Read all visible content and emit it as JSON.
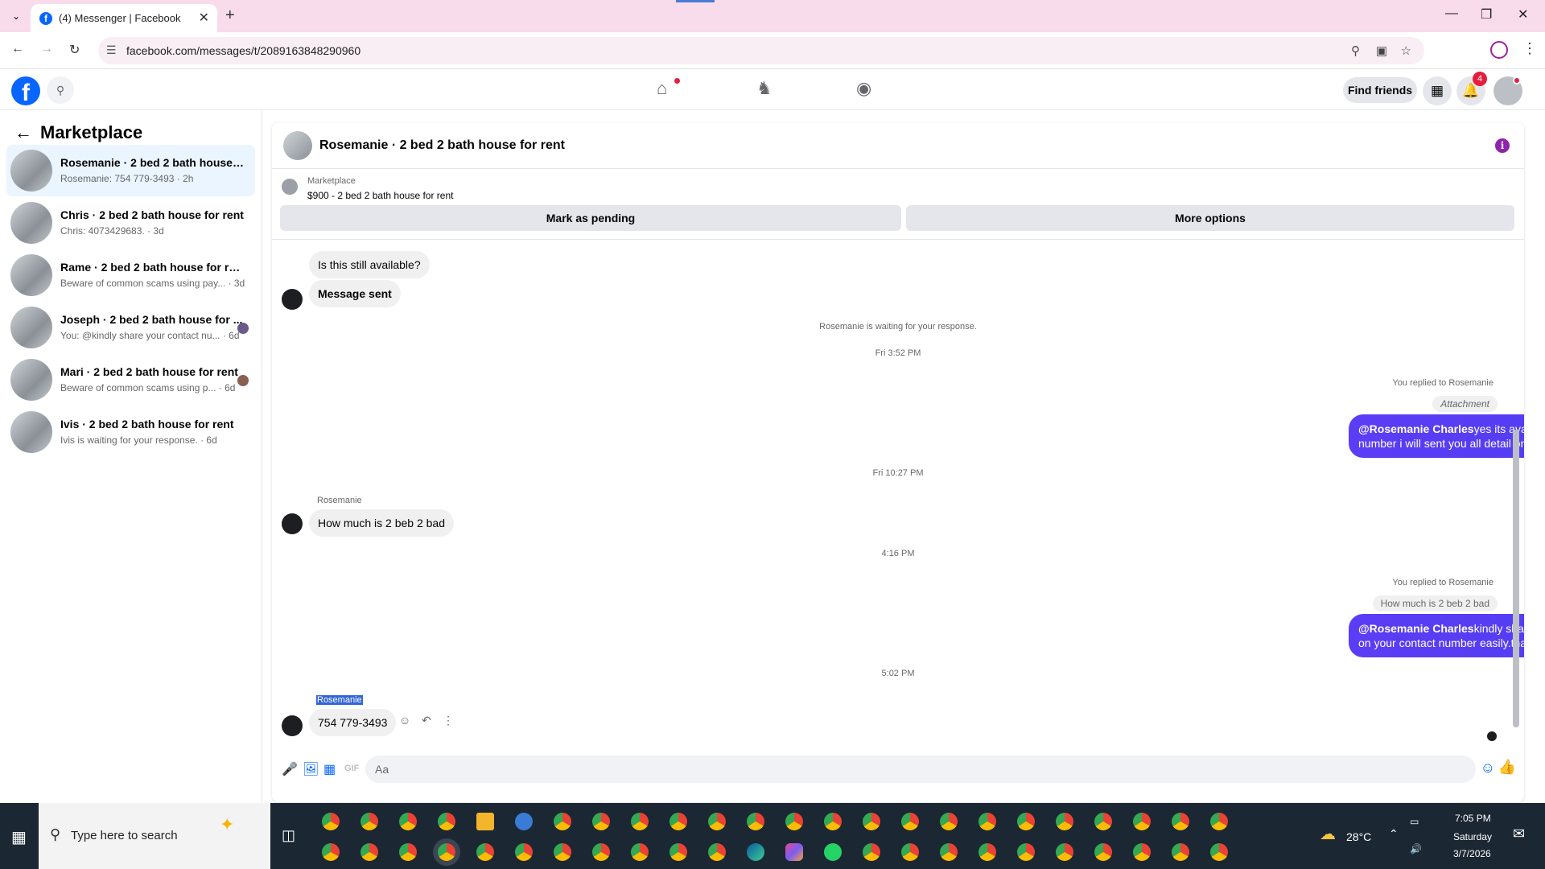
{
  "browser": {
    "tab_title": "(4) Messenger | Facebook",
    "url": "facebook.com/messages/t/2089163848290960"
  },
  "header": {
    "find_friends_label": "Find friends",
    "notif_count": "4"
  },
  "sidebar": {
    "title": "Marketplace",
    "conversations": [
      {
        "name": "Rosemanie · 2 bed 2 bath house fo...",
        "snippet": "Rosemanie: 754 779-3493 · 2h"
      },
      {
        "name": "Chris · 2 bed 2 bath house for rent",
        "snippet": "Chris: 4073429683. · 3d"
      },
      {
        "name": "Rame · 2 bed 2 bath house for rent",
        "snippet": "Beware of common scams using pay... · 3d"
      },
      {
        "name": "Joseph · 2 bed 2 bath house for ...",
        "snippet": "You: @kindly share your contact nu... · 6d"
      },
      {
        "name": "Mari · 2 bed 2 bath house for rent",
        "snippet": "Beware of common scams using p... · 6d"
      },
      {
        "name": "Ivis · 2 bed 2 bath house for rent",
        "snippet": "Ivis is waiting for your response. · 6d"
      }
    ]
  },
  "chat": {
    "title": "Rosemanie · 2 bed 2 bath house for rent",
    "marketplace_label": "Marketplace",
    "listing": "$900 - 2 bed 2 bath house for rent",
    "mark_pending": "Mark as pending",
    "more_options": "More options",
    "msg_available": "Is this still available?",
    "msg_sent": "Message sent",
    "waiting": "Rosemanie is waiting for your response.",
    "time1": "Fri 3:52 PM",
    "replied1": "You replied to Rosemanie",
    "attachment": "Attachment",
    "out1_mention": "@Rosemanie Charles",
    "out1_text": "yes its available for rent please share your contact number i will sent you all detail on your contact number.",
    "time2": "Fri 10:27 PM",
    "sender": "Rosemanie",
    "msg_price": "How much is 2 beb 2 bad",
    "time3": "4:16 PM",
    "replied2": "You replied to Rosemanie",
    "quoted": "How much is 2 beb 2 bad",
    "out2_mention": "@Rosemanie Charles",
    "out2_text": "kindly share your contact number i will sent you all detail on your contact number easily.thanks",
    "time4": "5:02 PM",
    "sender2": "Rosemanie",
    "msg_phone": "754 779-3493",
    "composer_placeholder": "Aa"
  },
  "taskbar": {
    "search_placeholder": "Type here to search",
    "temperature": "28°C",
    "time": "7:05 PM",
    "day": "Saturday",
    "date": "3/7/2026"
  }
}
